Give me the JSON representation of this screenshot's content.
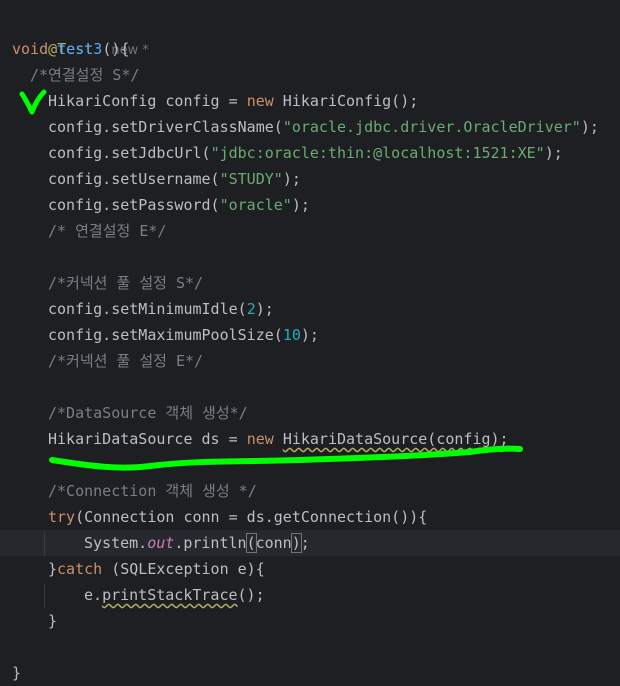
{
  "code": {
    "annotation": "@Test",
    "hint_new": "new *",
    "kw_void": "void",
    "method_name": "test3",
    "open_sig": "(){",
    "cm1": "/*연결설정 S*/",
    "l3_type": "HikariConfig config = ",
    "kw_new": "new",
    "l3_rest": " HikariConfig();",
    "l4_pre": "config.setDriverClassName(",
    "l4_str": "\"oracle.jdbc.driver.OracleDriver\"",
    "l4_post": ");",
    "l5_pre": "config.setJdbcUrl(",
    "l5_str": "\"jdbc:oracle:thin:@localhost:1521:XE\"",
    "l5_post": ");",
    "l6_pre": "config.setUsername(",
    "l6_str": "\"STUDY\"",
    "l6_post": ");",
    "l7_pre": "config.setPassword(",
    "l7_str": "\"oracle\"",
    "l7_post": ");",
    "cm2": "/* 연결설정 E*/",
    "cm3": "/*커넥션 풀 설정 S*/",
    "l10_pre": "config.setMinimumIdle(",
    "l10_num": "2",
    "l10_post": ");",
    "l11_pre": "config.setMaximumPoolSize(",
    "l11_num": "10",
    "l11_post": ");",
    "cm4": "/*커넥션 풀 설정 E*/",
    "cm5": "/*DataSource 객체 생성*/",
    "l15_pre": "HikariDataSource ds = ",
    "l15_sq": "HikariDataSource(config);",
    "cm6": "/*Connection 객체 생성 */",
    "kw_try": "try",
    "l18_rest": "(Connection conn = ds.getConnection()){",
    "l19_pre": "System.",
    "l19_field": "out",
    "l19_mid": ".println",
    "l19_paren": "(",
    "l19_arg": "conn",
    "l19_close": ")",
    "l19_semi": ";",
    "close_brace": "}",
    "kw_catch": "catch",
    "l20_rest": " (SQLException e){",
    "l21_pre": "e.",
    "l21_sq": "printStackTrace",
    "l21_post": "();",
    "close_inner": "}",
    "close_method": "}"
  },
  "colors": {
    "background": "#1e1f22",
    "keyword": "#cf8e6d",
    "method": "#56a8f5",
    "string": "#6aab73",
    "number": "#2aacb8",
    "comment": "#7a7e85",
    "annotation_marks": "#00ff00"
  }
}
